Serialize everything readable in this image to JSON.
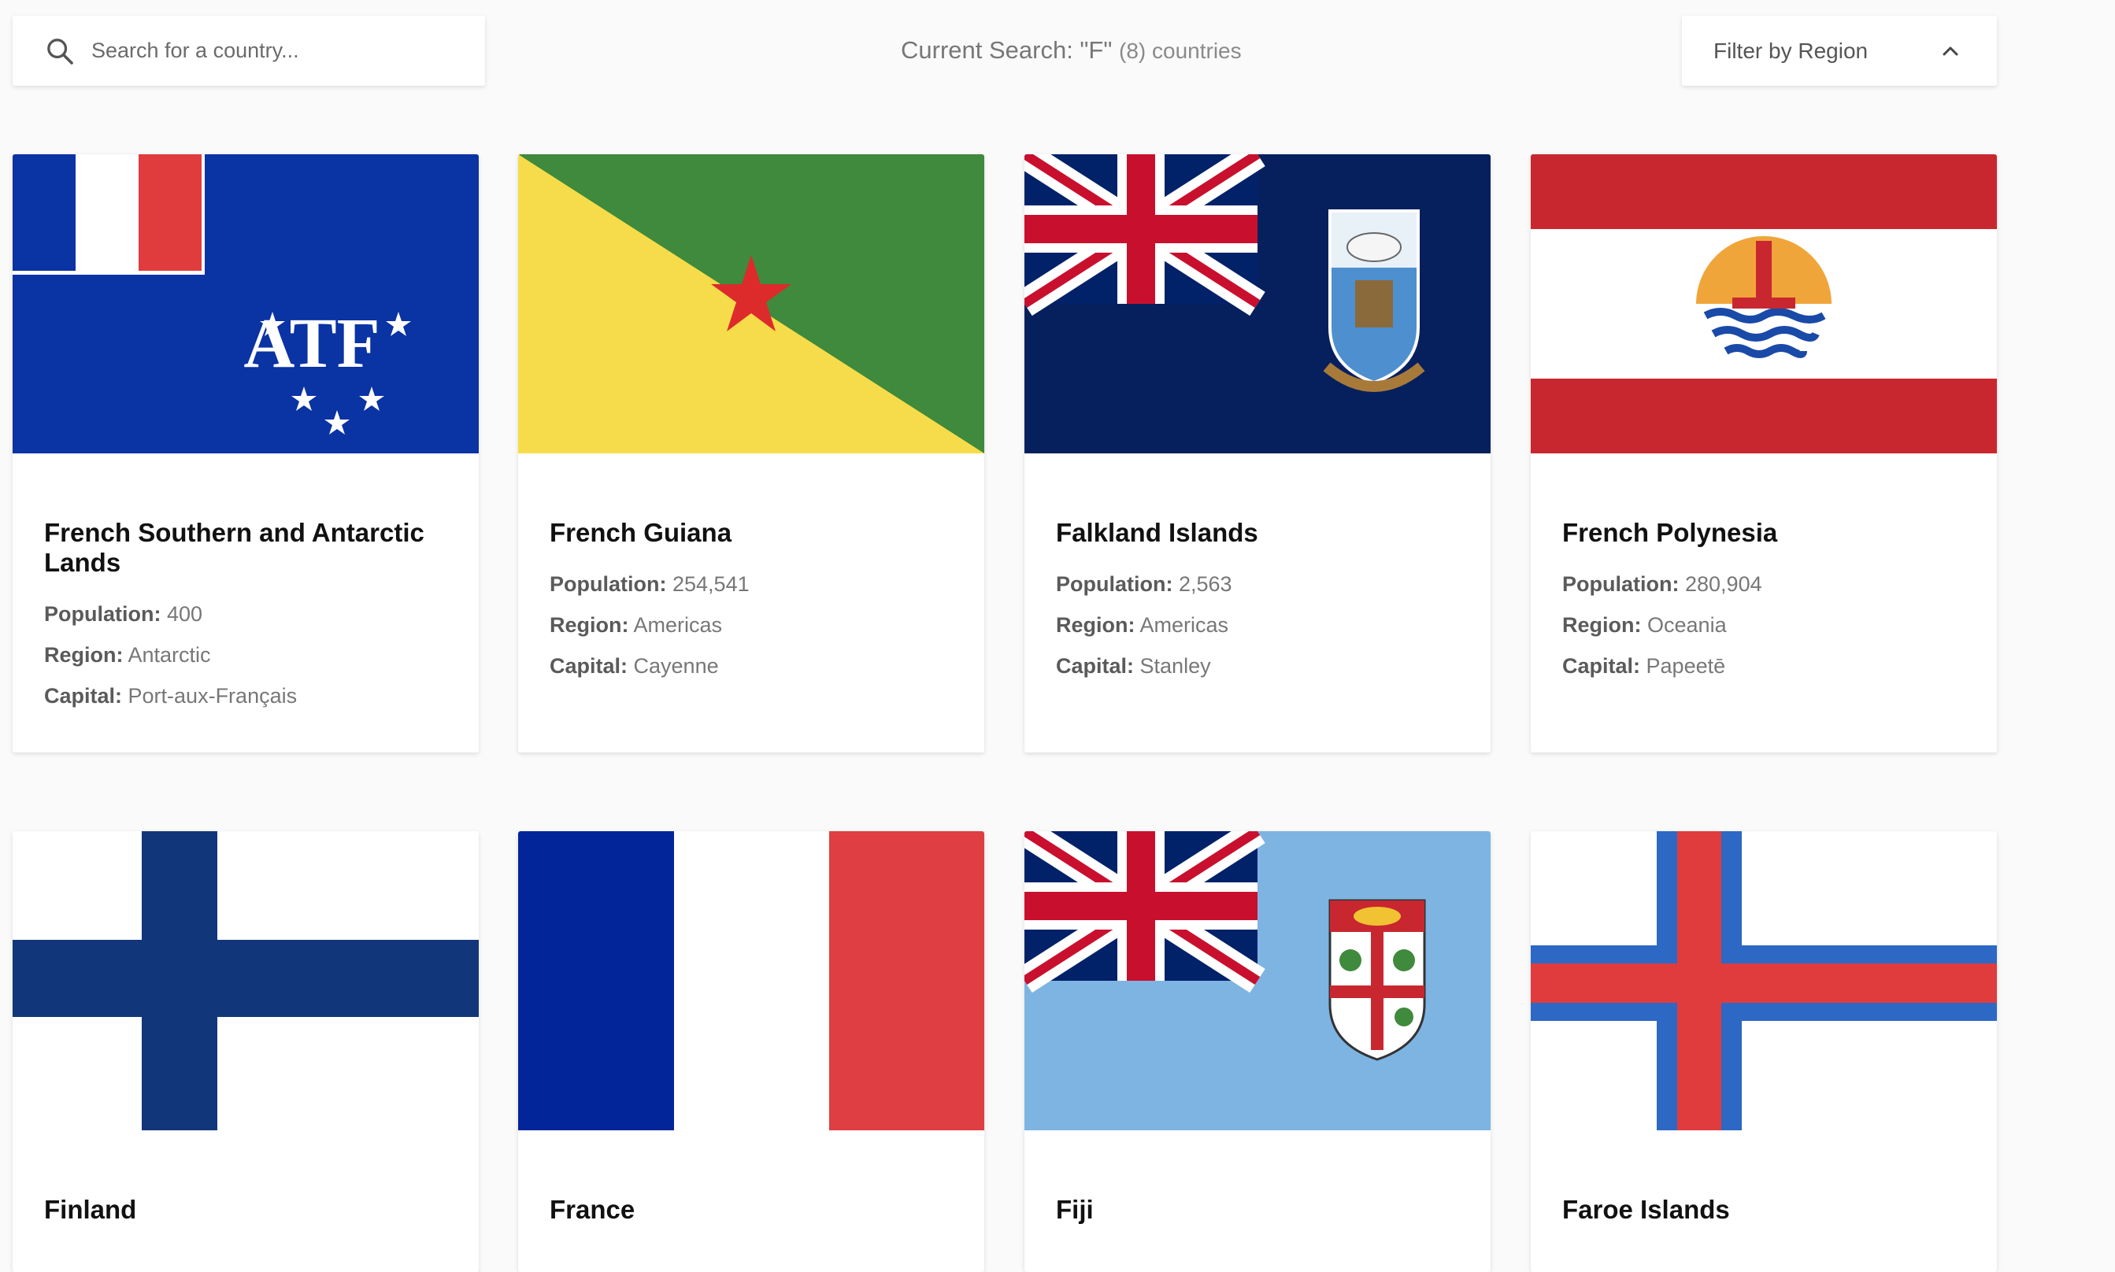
{
  "search": {
    "placeholder": "Search for a country...",
    "icon": "search-icon"
  },
  "status": {
    "label": "Current Search: \"F\"",
    "count": "(8) countries"
  },
  "filter": {
    "label": "Filter by Region",
    "icon": "chevron-up-icon"
  },
  "stat_labels": {
    "population": "Population:",
    "region": "Region:",
    "capital": "Capital:"
  },
  "countries": [
    {
      "name": "French Southern and Antarctic Lands",
      "population": "400",
      "region": "Antarctic",
      "capital": "Port-aux-Français",
      "flag": "french-southern-lands-flag"
    },
    {
      "name": "French Guiana",
      "population": "254,541",
      "region": "Americas",
      "capital": "Cayenne",
      "flag": "french-guiana-flag"
    },
    {
      "name": "Falkland Islands",
      "population": "2,563",
      "region": "Americas",
      "capital": "Stanley",
      "flag": "falkland-islands-flag"
    },
    {
      "name": "French Polynesia",
      "population": "280,904",
      "region": "Oceania",
      "capital": "Papeetē",
      "flag": "french-polynesia-flag"
    },
    {
      "name": "Finland",
      "flag": "finland-flag"
    },
    {
      "name": "France",
      "flag": "france-flag"
    },
    {
      "name": "Fiji",
      "flag": "fiji-flag"
    },
    {
      "name": "Faroe Islands",
      "flag": "faroe-islands-flag"
    }
  ],
  "colors": {
    "background": "#fafafa",
    "card": "#ffffff",
    "heading": "#111111",
    "muted": "#777777"
  }
}
